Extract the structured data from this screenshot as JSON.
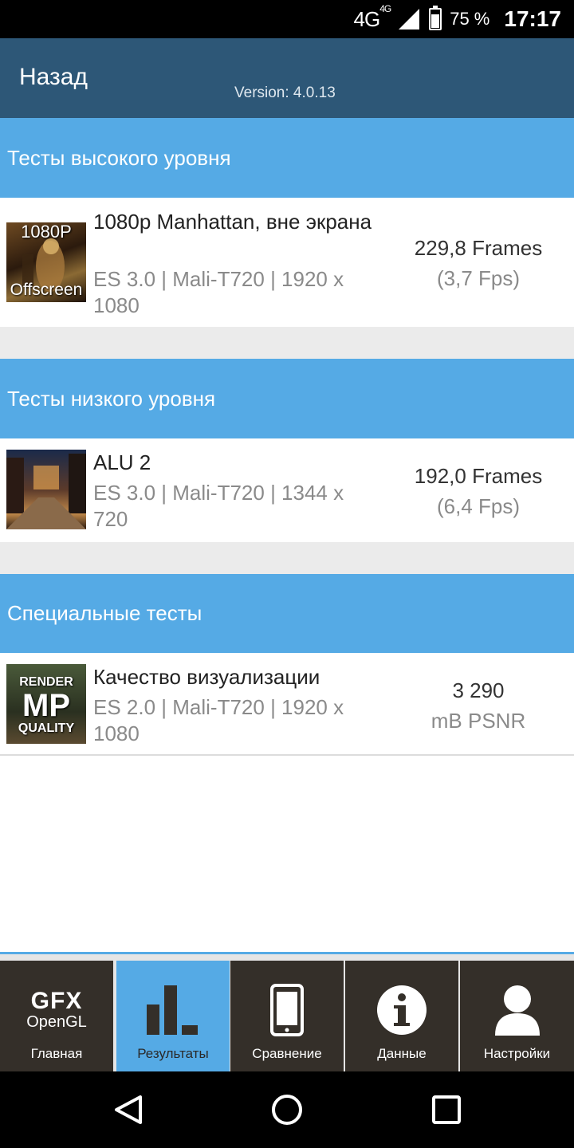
{
  "status": {
    "network": "4G",
    "network_sup": "4G",
    "battery": "75 %",
    "time": "17:17"
  },
  "header": {
    "back": "Назад",
    "version": "Version: 4.0.13"
  },
  "sections": [
    {
      "title": "Тесты высокого уровня",
      "items": [
        {
          "thumb_line1": "1080P",
          "thumb_line2": "Offscreen",
          "title": "1080p Manhattan, вне экрана",
          "sub": "ES 3.0 | Mali-T720 | 1920 x 1080",
          "score": "229,8 Frames",
          "score2": "(3,7 Fps)"
        }
      ]
    },
    {
      "title": "Тесты низкого уровня",
      "items": [
        {
          "title": "ALU 2",
          "sub": "ES 3.0 | Mali-T720 | 1344 x 720",
          "score": "192,0 Frames",
          "score2": "(6,4 Fps)"
        }
      ]
    },
    {
      "title": "Специальные тесты",
      "items": [
        {
          "thumb_line1": "RENDER",
          "thumb_line2": "MP",
          "thumb_line3": "QUALITY",
          "title": "Качество визуализации",
          "sub": "ES 2.0 | Mali-T720 | 1920 x 1080",
          "score": "3 290",
          "score2": "mB PSNR"
        }
      ]
    }
  ],
  "tabs": [
    {
      "label": "Главная",
      "logo1": "GFX",
      "logo2": "OpenGL",
      "icon": "gfx-logo-icon"
    },
    {
      "label": "Результаты",
      "icon": "bar-chart-icon",
      "active": true
    },
    {
      "label": "Сравнение",
      "icon": "phone-icon"
    },
    {
      "label": "Данные",
      "icon": "info-icon"
    },
    {
      "label": "Настройки",
      "icon": "user-icon"
    }
  ],
  "nav": [
    "back-nav-icon",
    "home-nav-icon",
    "recents-nav-icon"
  ]
}
